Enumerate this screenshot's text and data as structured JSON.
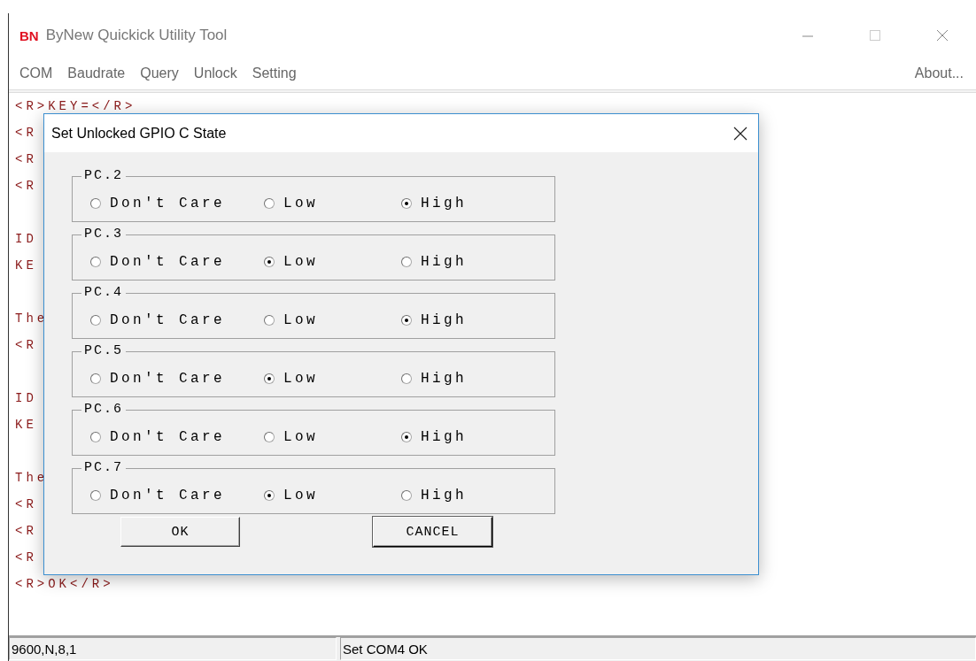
{
  "window": {
    "logo": "BN",
    "title": "ByNew Quickick Utility Tool"
  },
  "menu": [
    "COM",
    "Baudrate",
    "Query",
    "Unlock",
    "Setting"
  ],
  "menu_right": "About...",
  "log_blocks": [
    {
      "lines": [
        "<R>KEY=</R>",
        "<R",
        "<R",
        "<R"
      ]
    },
    {
      "lines": [
        "ID",
        "KE"
      ]
    },
    {
      "lines": [
        "The",
        "<R"
      ]
    },
    {
      "lines": [
        "ID",
        "KE"
      ]
    },
    {
      "lines": [
        "The",
        "<R",
        "<R",
        "<R",
        "<R>OK</R>"
      ]
    }
  ],
  "dialog": {
    "title": "Set Unlocked GPIO C State",
    "groups": [
      {
        "label": "PC.2",
        "options": [
          {
            "label": "Don't Care",
            "selected": false
          },
          {
            "label": "Low",
            "selected": false
          },
          {
            "label": "High",
            "selected": true
          }
        ]
      },
      {
        "label": "PC.3",
        "options": [
          {
            "label": "Don't Care",
            "selected": false
          },
          {
            "label": "Low",
            "selected": true
          },
          {
            "label": "High",
            "selected": false
          }
        ]
      },
      {
        "label": "PC.4",
        "options": [
          {
            "label": "Don't Care",
            "selected": false
          },
          {
            "label": "Low",
            "selected": false
          },
          {
            "label": "High",
            "selected": true
          }
        ]
      },
      {
        "label": "PC.5",
        "options": [
          {
            "label": "Don't Care",
            "selected": false
          },
          {
            "label": "Low",
            "selected": true
          },
          {
            "label": "High",
            "selected": false
          }
        ]
      },
      {
        "label": "PC.6",
        "options": [
          {
            "label": "Don't Care",
            "selected": false
          },
          {
            "label": "Low",
            "selected": false
          },
          {
            "label": "High",
            "selected": true
          }
        ]
      },
      {
        "label": "PC.7",
        "options": [
          {
            "label": "Don't Care",
            "selected": false
          },
          {
            "label": "Low",
            "selected": true
          },
          {
            "label": "High",
            "selected": false
          }
        ]
      }
    ],
    "buttons": [
      "OK",
      "CANCEL"
    ]
  },
  "status_bar": [
    "9600,N,8,1",
    "Set COM4 OK"
  ]
}
